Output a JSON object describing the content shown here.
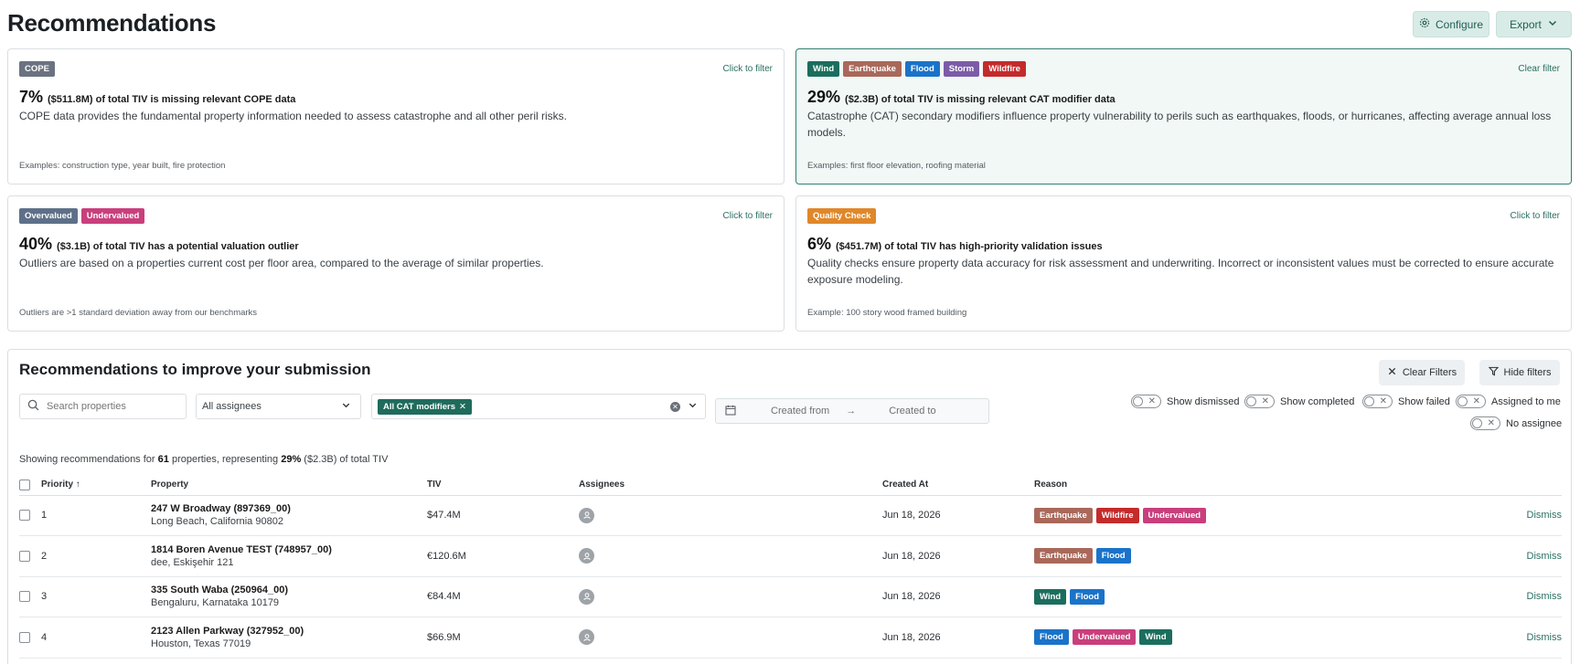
{
  "header": {
    "title": "Recommendations",
    "configure_label": "Configure",
    "export_label": "Export"
  },
  "colors": {
    "accent": "#1f6b5c",
    "cope": "#6b7280",
    "wind": "#1b6e5d",
    "earthquake": "#a9685a",
    "flood": "#1a73c9",
    "storm": "#7b5ca8",
    "wildfire": "#c42b2b",
    "overvalued": "#5e7089",
    "undervalued": "#c93f7c",
    "quality_check": "#e0872a"
  },
  "cards": [
    {
      "badges": [
        "COPE"
      ],
      "link": "Click to filter",
      "pct": "7%",
      "stat_text": "($511.8M) of total TIV is missing relevant COPE data",
      "description": "COPE data provides the fundamental property information needed to assess catastrophe and all other peril risks.",
      "example": "Examples: construction type, year built, fire protection"
    },
    {
      "badges": [
        "Wind",
        "Earthquake",
        "Flood",
        "Storm",
        "Wildfire"
      ],
      "link": "Clear filter",
      "pct": "29%",
      "stat_text": "($2.3B) of total TIV is missing relevant CAT modifier data",
      "description": "Catastrophe (CAT) secondary modifiers influence property vulnerability to perils such as earthquakes, floods, or hurricanes, affecting average annual loss models.",
      "example": "Examples: first floor elevation, roofing material"
    },
    {
      "badges": [
        "Overvalued",
        "Undervalued"
      ],
      "link": "Click to filter",
      "pct": "40%",
      "stat_text": "($3.1B) of total TIV has a potential valuation outlier",
      "description": "Outliers are based on a properties current cost per floor area, compared to the average of similar properties.",
      "example": "Outliers are >1 standard deviation away from our benchmarks"
    },
    {
      "badges": [
        "Quality Check"
      ],
      "link": "Click to filter",
      "pct": "6%",
      "stat_text": "($451.7M) of total TIV has high-priority validation issues",
      "description": "Quality checks ensure property data accuracy for risk assessment and underwriting. Incorrect or inconsistent values must be corrected to ensure accurate exposure modeling.",
      "example": "Example: 100 story wood framed building"
    }
  ],
  "panel": {
    "title": "Recommendations to improve your submission",
    "clear_filters_label": "Clear Filters",
    "hide_filters_label": "Hide filters",
    "search_placeholder": "Search properties",
    "assignees_value": "All assignees",
    "chip_label": "All CAT modifiers",
    "created_from_placeholder": "Created from",
    "created_to_placeholder": "Created to",
    "toggles": {
      "dismissed": "Show dismissed",
      "completed": "Show completed",
      "failed": "Show failed",
      "assigned": "Assigned to me",
      "no_assignee": "No assignee"
    },
    "summary": {
      "prefix": "Showing recommendations for",
      "count": "61",
      "middle": "properties, representing",
      "pct": "29%",
      "suffix": "($2.3B) of total TIV"
    }
  },
  "table": {
    "columns": {
      "priority": "Priority",
      "property": "Property",
      "tiv": "TIV",
      "assignees": "Assignees",
      "created": "Created At",
      "reason": "Reason"
    },
    "rows": [
      {
        "priority": "1",
        "name": "247 W Broadway (897369_00)",
        "address": "Long Beach, California 90802",
        "tiv": "$47.4M",
        "created": "Jun 18, 2026",
        "reasons": [
          "Earthquake",
          "Wildfire",
          "Undervalued"
        ],
        "action": "Dismiss"
      },
      {
        "priority": "2",
        "name": "1814 Boren Avenue TEST (748957_00)",
        "address": "dee, Eskişehir 121",
        "tiv": "€120.6M",
        "created": "Jun 18, 2026",
        "reasons": [
          "Earthquake",
          "Flood"
        ],
        "action": "Dismiss"
      },
      {
        "priority": "3",
        "name": "335 South Waba (250964_00)",
        "address": "Bengaluru, Karnataka 10179",
        "tiv": "€84.4M",
        "created": "Jun 18, 2026",
        "reasons": [
          "Wind",
          "Flood"
        ],
        "action": "Dismiss"
      },
      {
        "priority": "4",
        "name": "2123 Allen Parkway (327952_00)",
        "address": "Houston, Texas 77019",
        "tiv": "$66.9M",
        "created": "Jun 18, 2026",
        "reasons": [
          "Flood",
          "Undervalued",
          "Wind"
        ],
        "action": "Dismiss"
      }
    ]
  }
}
